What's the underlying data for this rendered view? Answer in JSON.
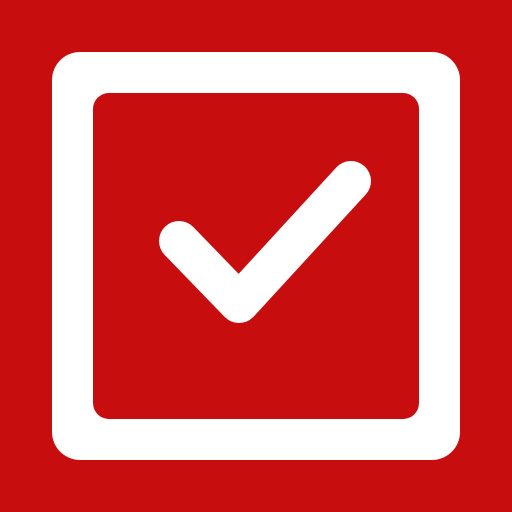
{
  "icon": {
    "name": "checked-checkbox-icon",
    "state": "checked",
    "colors": {
      "background": "#C80D0F",
      "frame": "#FFFFFF",
      "inner": "#C80D0F",
      "checkmark": "#FFFFFF"
    }
  }
}
